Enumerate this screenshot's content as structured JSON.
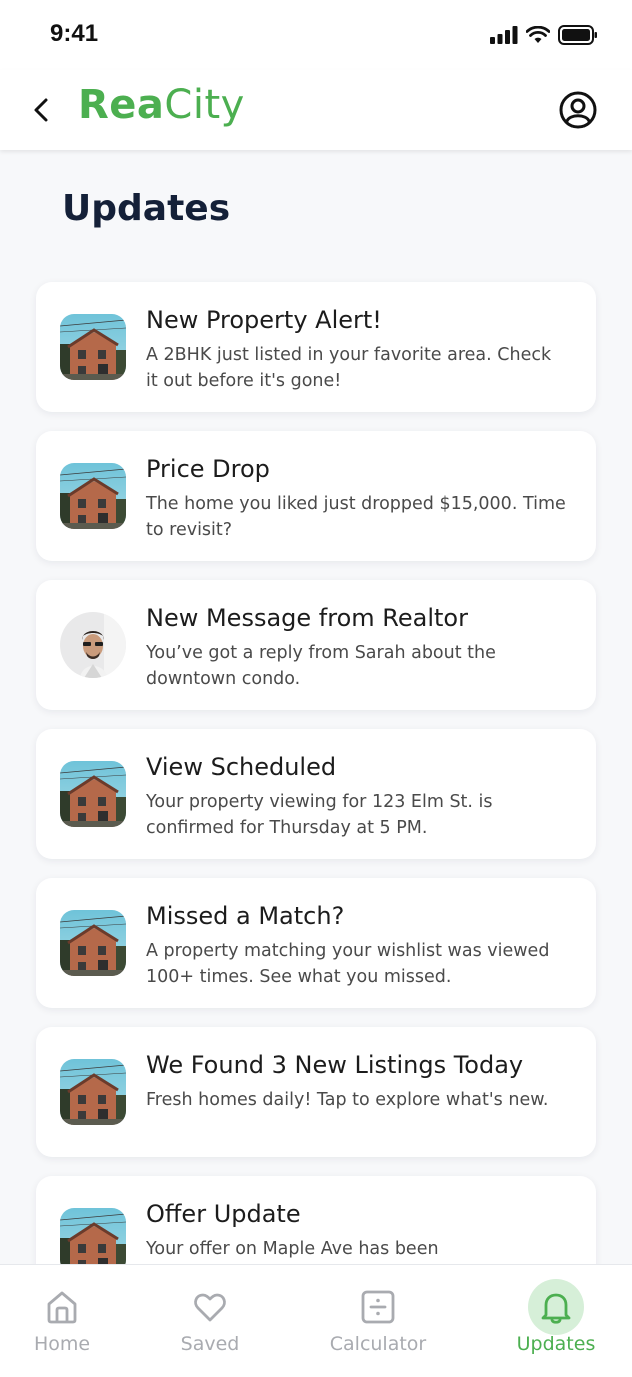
{
  "status_bar": {
    "time": "9:41"
  },
  "header": {
    "brand_part1": "Rea",
    "brand_part2": "City"
  },
  "page": {
    "title": "Updates"
  },
  "colors": {
    "brand_green": "#4caf50",
    "title_navy": "#142038",
    "active_tab_bg": "#d6efd8",
    "inactive_tab": "#a9abb0"
  },
  "updates": [
    {
      "title": "New Property Alert!",
      "body": "A 2BHK just listed in your favorite area. Check it out before it's gone!",
      "image": "house-thumbnail"
    },
    {
      "title": "Price Drop",
      "body": "The home you liked just dropped $15,000. Time to revisit?",
      "image": "house-thumbnail"
    },
    {
      "title": "New Message from Realtor",
      "body": "You’ve got a reply from Sarah about the downtown condo.",
      "image": "realtor-avatar"
    },
    {
      "title": "View Scheduled",
      "body": "Your property viewing for 123 Elm St. is confirmed for Thursday at 5 PM.",
      "image": "house-thumbnail"
    },
    {
      "title": "Missed a Match?",
      "body": "A property matching your wishlist was viewed 100+ times. See what you missed.",
      "image": "house-thumbnail"
    },
    {
      "title": "We Found 3 New Listings Today",
      "body": "Fresh homes daily! Tap to explore what's new.",
      "image": "house-thumbnail"
    },
    {
      "title": "Offer Update",
      "body": "Your offer on Maple Ave has been",
      "image": "house-thumbnail"
    }
  ],
  "tabs": [
    {
      "label": "Home",
      "icon": "home-icon",
      "active": false
    },
    {
      "label": "Saved",
      "icon": "heart-icon",
      "active": false
    },
    {
      "label": "Calculator",
      "icon": "calculator-icon",
      "active": false
    },
    {
      "label": "Updates",
      "icon": "bell-icon",
      "active": true
    }
  ]
}
